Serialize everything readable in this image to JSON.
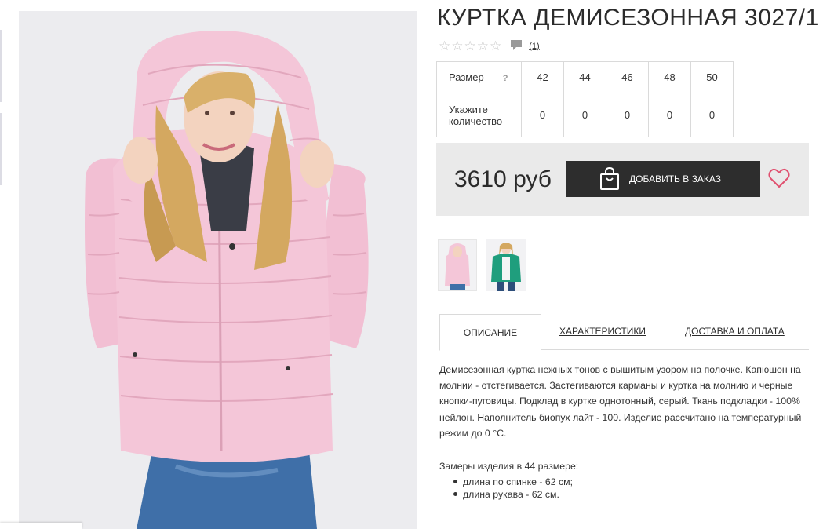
{
  "product": {
    "title": "КУРТКА ДЕМИСЕЗОННАЯ 3027/1",
    "rating": 0,
    "rating_max": 5,
    "review_count": "(1)"
  },
  "size_table": {
    "size_label": "Размер",
    "help_mark": "?",
    "sizes": [
      "42",
      "44",
      "46",
      "48",
      "50"
    ],
    "quantity_label": "Укажите количество",
    "quantities": [
      "0",
      "0",
      "0",
      "0",
      "0"
    ]
  },
  "buy": {
    "price": "3610 руб",
    "add_button_label": "ДОБАВИТЬ В ЗАКАЗ"
  },
  "tabs": [
    {
      "label": "ОПИСАНИЕ",
      "active": true
    },
    {
      "label": "ХАРАКТЕРИСТИКИ",
      "active": false
    },
    {
      "label": "ДОСТАВКА И ОПЛАТА",
      "active": false
    }
  ],
  "description": {
    "text": "Демисезонная куртка нежных тонов с вышитым узором на полочке. Капюшон на молнии - отстегивается. Застегиваются карманы и куртка на молнию и черные кнопки-пуговицы. Подклад в куртке однотонный, серый. Ткань подкладки - 100% нейлон. Наполнитель биопух лайт - 100. Изделие рассчитано на температурный режим до 0 °С.",
    "measure_title": "Замеры изделия в 44 размере:",
    "measures": [
      "длина по спинке - 62 см;",
      "длина рукава - 62 см."
    ]
  },
  "colors": {
    "jacket_pink": "#f4c6d8",
    "button_dark": "#2d2d2d",
    "heart": "#e0506f",
    "panel_bg": "#eaeaea",
    "thumb2_jacket": "#1f9e7d"
  },
  "icons": {
    "star": "star-outline",
    "comment": "speech-bubble",
    "bag": "shopping-bag",
    "heart": "heart-outline"
  }
}
